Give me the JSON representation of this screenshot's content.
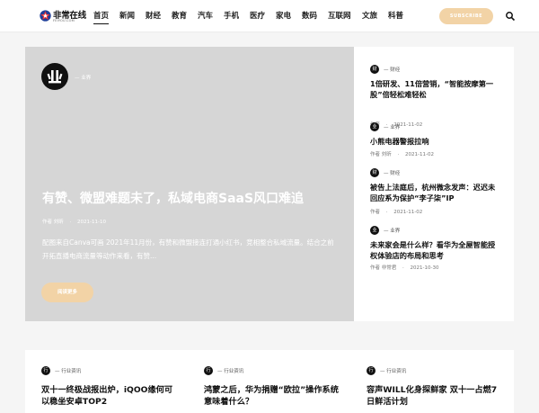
{
  "header": {
    "logo_name": "非常在线",
    "logo_sub": "FEIYOU.COM",
    "nav": [
      "首页",
      "新闻",
      "财经",
      "教育",
      "汽车",
      "手机",
      "医疗",
      "家电",
      "数码",
      "互联网",
      "文旅",
      "科普"
    ],
    "subscribe_label": "SUBSCRIBE",
    "accent": "#f2d3a6"
  },
  "hero": {
    "category": "— 业界",
    "title": "有赞、微盟难题未了，私域电商SaaS风口难追",
    "author": "作者  刘昕",
    "date": "2021-11-10",
    "excerpt": "配图来自Canva可画 2021年11月份，有赞和微盟接连打通小红书，竞相整合私域流量。结合之前开拓直播电商流量等动作来看，有赞...",
    "button_label": "阅读更多"
  },
  "side": [
    {
      "badge": "财",
      "category": "— 财经",
      "title": "1倍研发、11倍营销，“智能按摩第一股”倍轻松难轻松",
      "author": "作者",
      "date": "2021-11-02"
    },
    {
      "badge": "业",
      "category": "— 业界",
      "title": "小熊电器警报拉响",
      "author": "作者  刘昕",
      "date": "2021-11-02"
    },
    {
      "badge": "财",
      "category": "— 财经",
      "title": "被告上法庭后，杭州微念发声：迟迟未回应系为保护“李子柒”IP",
      "author": "作者",
      "date": "2021-11-02"
    },
    {
      "badge": "业",
      "category": "— 业界",
      "title": "未来家会是什么样？看华为全屋智能授权体验店的布局和思考",
      "author": "作者  非常君",
      "date": "2021-10-30"
    }
  ],
  "cards": [
    {
      "badge": "行",
      "category": "— 行业资讯",
      "title": "双十一终极战报出炉，iQOO缘何可以稳坐安卓TOP2"
    },
    {
      "badge": "行",
      "category": "— 行业资讯",
      "title": "鸿蒙之后，华为捐赠“欧拉”操作系统意味着什么？"
    },
    {
      "badge": "行",
      "category": "— 行业资讯",
      "title": "容声WILL化身探鲜家 双十一占燃7日鲜活计划"
    }
  ]
}
